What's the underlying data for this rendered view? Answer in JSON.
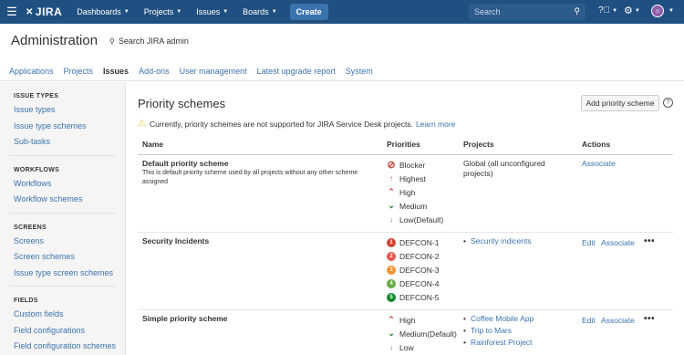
{
  "topnav": {
    "logo": "JIRA",
    "menu": [
      "Dashboards",
      "Projects",
      "Issues",
      "Boards"
    ],
    "create": "Create",
    "search_placeholder": "Search"
  },
  "admin": {
    "title": "Administration",
    "search": "Search JIRA admin"
  },
  "tabs": [
    "Applications",
    "Projects",
    "Issues",
    "Add-ons",
    "User management",
    "Latest upgrade report",
    "System"
  ],
  "active_tab": "Issues",
  "sidebar": [
    {
      "heading": "ISSUE TYPES",
      "links": [
        "Issue types",
        "Issue type schemes",
        "Sub-tasks"
      ]
    },
    {
      "heading": "WORKFLOWS",
      "links": [
        "Workflows",
        "Workflow schemes"
      ]
    },
    {
      "heading": "SCREENS",
      "links": [
        "Screens",
        "Screen schemes",
        "Issue type screen schemes"
      ]
    },
    {
      "heading": "FIELDS",
      "links": [
        "Custom fields",
        "Field configurations",
        "Field configuration schemes"
      ]
    }
  ],
  "page": {
    "title": "Priority schemes",
    "add_button": "Add priority scheme",
    "warning": "Currently, priority schemes are not supported for JIRA Service Desk projects.",
    "learn_more": "Learn more"
  },
  "table": {
    "headers": [
      "Name",
      "Priorities",
      "Projects",
      "Actions"
    ],
    "rows": [
      {
        "name": "Default priority scheme",
        "description": "This is default priority scheme used by all projects without any other scheme assigned",
        "priorities": [
          "Blocker",
          "Highest",
          "High",
          "Medium",
          "Low(Default)"
        ],
        "projects_text": "Global (all unconfigured projects)",
        "actions": [
          "Associate"
        ]
      },
      {
        "name": "Security Incidents",
        "priorities": [
          "DEFCON-1",
          "DEFCON-2",
          "DEFCON-3",
          "DEFCON-4",
          "DEFCON-5"
        ],
        "projects": [
          "Security indicents"
        ],
        "actions": [
          "Edit",
          "Associate"
        ]
      },
      {
        "name": "Simple priority scheme",
        "priorities": [
          "High",
          "Medium(Default)",
          "Low"
        ],
        "projects": [
          "Coffee Mobile App",
          "Trip to Mars",
          "Rainforest Project"
        ],
        "actions": [
          "Edit",
          "Associate"
        ]
      }
    ]
  },
  "colors": {
    "nav_bg": "#205081",
    "link": "#3b73af",
    "blocker": "#d04437",
    "defcon1": "#d04437",
    "defcon2": "#e8564b",
    "defcon3": "#f79232",
    "defcon4": "#67ab49",
    "defcon5": "#14892c"
  }
}
